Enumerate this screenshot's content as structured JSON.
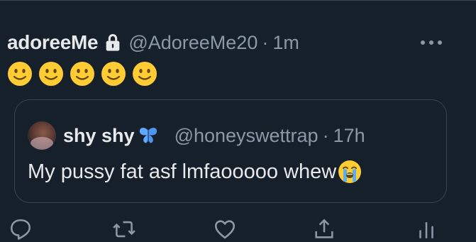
{
  "tweet": {
    "display_name": "adoreeMe",
    "handle": "@AdoreeMe20",
    "separator": "·",
    "time": "1m",
    "emojis": [
      "slightly-smiling-face",
      "slightly-smiling-face",
      "slightly-smiling-face",
      "slightly-smiling-face",
      "slightly-smiling-face"
    ]
  },
  "quote": {
    "display_name": "shy shy",
    "handle": "@honeyswettrap",
    "separator": "·",
    "time": "17h",
    "text": "My pussy fat asf lmfaooooo whew",
    "trailing_emoji": "loudly-crying-face"
  },
  "icons": {
    "lock": "lock-icon",
    "more": "more-options-icon",
    "verified_butterfly": "butterfly-icon",
    "reply": "reply-icon",
    "retweet": "retweet-icon",
    "like": "like-icon",
    "share": "share-icon",
    "analytics": "analytics-icon"
  },
  "colors": {
    "background": "#15202b",
    "primary_text": "#e7e9ea",
    "secondary_text": "#8b98a5",
    "border": "#38444d",
    "emoji_yellow": "#ffcc33",
    "butterfly_blue": "#5ea9ff"
  }
}
